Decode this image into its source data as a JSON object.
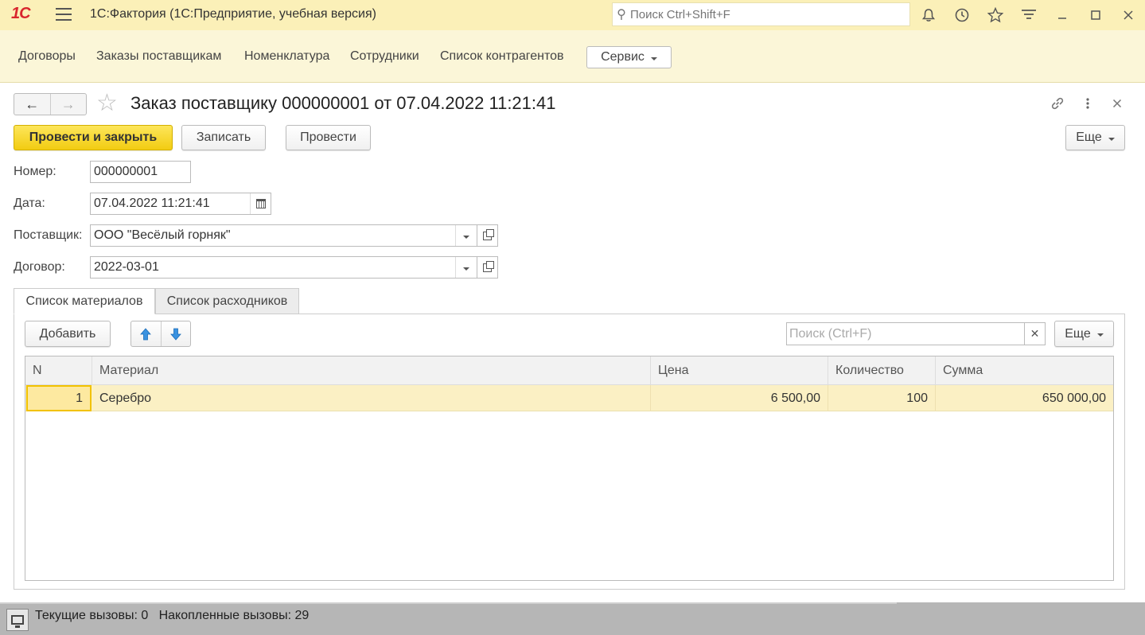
{
  "app": {
    "logo": "1С",
    "title": "1С:Фактория  (1С:Предприятие, учебная версия)",
    "search_placeholder": "Поиск Ctrl+Shift+F"
  },
  "nav": {
    "items": [
      "Договоры",
      "Заказы поставщикам",
      "Номенклатура",
      "Сотрудники",
      "Список контрагентов"
    ],
    "service_label": "Сервис"
  },
  "form": {
    "title": "Заказ поставщику 000000001 от 07.04.2022 11:21:41",
    "buttons": {
      "post_close": "Провести и закрыть",
      "save": "Записать",
      "post": "Провести",
      "more": "Еще"
    },
    "fields": {
      "number_label": "Номер:",
      "number_value": "000000001",
      "date_label": "Дата:",
      "date_value": "07.04.2022 11:21:41",
      "supplier_label": "Поставщик:",
      "supplier_value": "ООО \"Весёлый горняк\"",
      "contract_label": "Договор:",
      "contract_value": "2022-03-01"
    },
    "tabs": [
      "Список материалов",
      "Список расходников"
    ],
    "table_toolbar": {
      "add": "Добавить",
      "search_placeholder": "Поиск (Ctrl+F)",
      "more": "Еще"
    },
    "table": {
      "columns": [
        "N",
        "Материал",
        "Цена",
        "Количество",
        "Сумма"
      ],
      "rows": [
        {
          "n": "1",
          "material": "Серебро",
          "price": "6 500,00",
          "qty": "100",
          "sum": "650 000,00"
        }
      ]
    }
  },
  "status": {
    "text": "Текущие вызовы: 0   Накопленные вызовы: 29"
  },
  "colors": {
    "titlebar_bg": "#fbf0b8",
    "primary_button": "#f2cc12",
    "selected_row": "#fbf0c4",
    "logo_red": "#d8262d"
  }
}
